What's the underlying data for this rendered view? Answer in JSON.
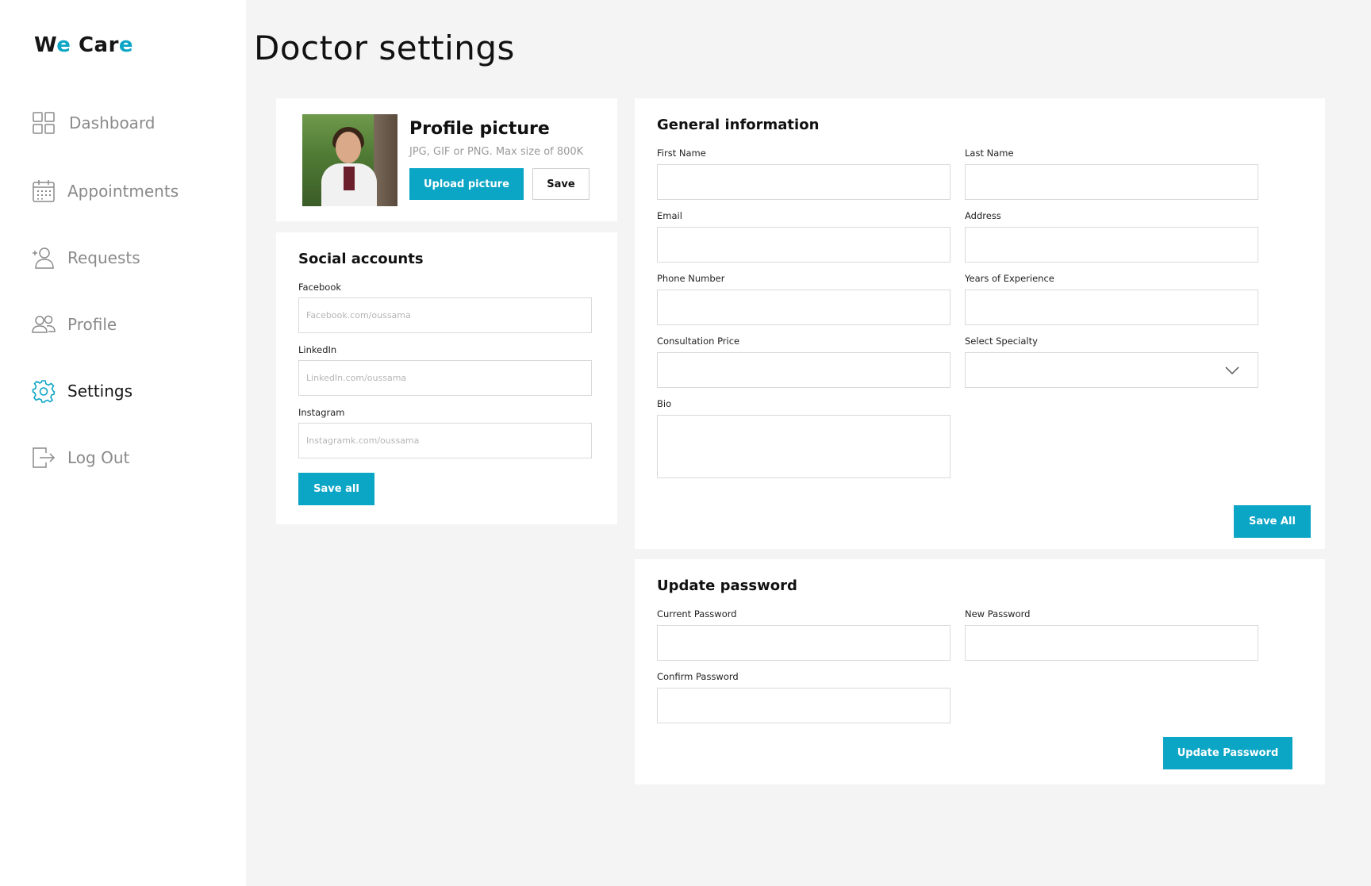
{
  "brand": {
    "part1_a": "W",
    "part1_b": "e",
    "part2_a": "Car",
    "part2_b": "e"
  },
  "page_title": "Doctor settings",
  "colors": {
    "accent": "#0ba5c5",
    "background": "#f4f4f4",
    "card": "#ffffff"
  },
  "sidebar": {
    "items": [
      {
        "label": "Dashboard",
        "icon": "dashboard-grid-icon",
        "active": false
      },
      {
        "label": "Appointments",
        "icon": "calendar-icon",
        "active": false
      },
      {
        "label": "Requests",
        "icon": "add-user-icon",
        "active": false
      },
      {
        "label": "Profile",
        "icon": "users-icon",
        "active": false
      },
      {
        "label": "Settings",
        "icon": "gear-icon",
        "active": true
      },
      {
        "label": "Log Out",
        "icon": "logout-icon",
        "active": false
      }
    ]
  },
  "profile_picture": {
    "title": "Profile picture",
    "hint": "JPG, GIF or PNG. Max size of 800K",
    "upload_label": "Upload picture",
    "save_label": "Save"
  },
  "social": {
    "title": "Social accounts",
    "facebook": {
      "label": "Facebook",
      "placeholder": "Facebook.com/oussama"
    },
    "linkedin": {
      "label": "LinkedIn",
      "placeholder": "LinkedIn.com/oussama"
    },
    "instagram": {
      "label": "Instagram",
      "placeholder": "Instagramk.com/oussama"
    },
    "save_label": "Save all"
  },
  "general": {
    "title": "General information",
    "first_name": {
      "label": "First Name",
      "value": ""
    },
    "last_name": {
      "label": "Last Name",
      "value": ""
    },
    "email": {
      "label": "Email",
      "value": ""
    },
    "address": {
      "label": "Address",
      "value": ""
    },
    "phone": {
      "label": "Phone Number",
      "value": ""
    },
    "experience": {
      "label": "Years of Experience",
      "value": ""
    },
    "price": {
      "label": "Consultation Price",
      "value": ""
    },
    "specialty": {
      "label": "Select Specialty",
      "value": ""
    },
    "bio": {
      "label": "Bio",
      "value": ""
    },
    "save_label": "Save All"
  },
  "password": {
    "title": "Update password",
    "current": {
      "label": "Current Password",
      "value": ""
    },
    "new": {
      "label": "New Password",
      "value": ""
    },
    "confirm": {
      "label": "Confirm Password",
      "value": ""
    },
    "update_label": "Update Password"
  }
}
